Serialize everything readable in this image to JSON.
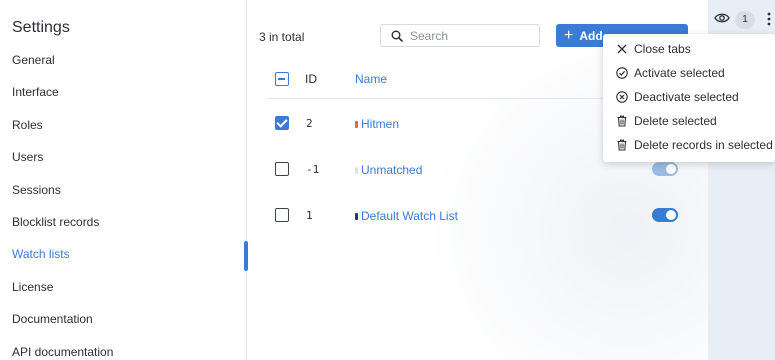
{
  "sidebar": {
    "title": "Settings",
    "items": [
      {
        "label": "General",
        "active": false
      },
      {
        "label": "Interface",
        "active": false
      },
      {
        "label": "Roles",
        "active": false
      },
      {
        "label": "Users",
        "active": false
      },
      {
        "label": "Sessions",
        "active": false
      },
      {
        "label": "Blocklist records",
        "active": false
      },
      {
        "label": "Watch lists",
        "active": true
      },
      {
        "label": "License",
        "active": false
      },
      {
        "label": "Documentation",
        "active": false
      },
      {
        "label": "API documentation",
        "active": false
      }
    ]
  },
  "toolbar": {
    "total": "3 in total",
    "search_placeholder": "Search",
    "add_label": "Add"
  },
  "table": {
    "columns": {
      "id": "ID",
      "name": "Name"
    },
    "rows": [
      {
        "id": "2",
        "name": "Hitmen",
        "checked": true,
        "dot_color": "#e8643c",
        "enabled": true
      },
      {
        "id": "-1",
        "name": "Unmatched",
        "checked": false,
        "dot_color": "#dfe3ea",
        "enabled": true
      },
      {
        "id": "1",
        "name": "Default Watch List",
        "checked": false,
        "dot_color": "#1f3a5f",
        "enabled": true
      }
    ]
  },
  "topbar": {
    "badge_count": "1",
    "icons": [
      "eye-icon",
      "kebab-icon"
    ]
  },
  "menu": {
    "items": [
      {
        "label": "Close tabs",
        "icon": "close-icon"
      },
      {
        "label": "Activate selected",
        "icon": "check-circle-icon"
      },
      {
        "label": "Deactivate selected",
        "icon": "x-circle-icon"
      },
      {
        "label": "Delete selected",
        "icon": "trash-icon"
      },
      {
        "label": "Delete records in selected",
        "icon": "trash-icon"
      }
    ]
  },
  "colors": {
    "accent": "#3a7bd5",
    "text": "#2b2f36",
    "right_panel": "#e8eef6"
  }
}
